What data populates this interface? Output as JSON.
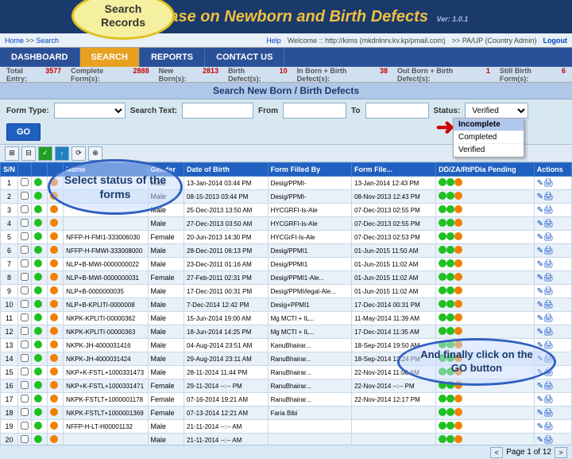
{
  "app": {
    "title": "abase on Newborn and Birth Defects",
    "version": "Ver: 1.0.1",
    "search_records_label": "Search\nRecords"
  },
  "info_bar": {
    "home": "Home",
    "search": "Search",
    "help": "Help",
    "welcome": "Welcome :: http://kims (mkdnlnrv.kv.kp/pmail.com)",
    "location": ">> PA/UP (Country Admin)",
    "logout": "Logout"
  },
  "nav": {
    "items": [
      {
        "label": "DASHBOARD",
        "active": false
      },
      {
        "label": "SEARCH",
        "active": true
      },
      {
        "label": "REPORTS",
        "active": false
      },
      {
        "label": "CONTACT US",
        "active": false
      }
    ]
  },
  "stats": {
    "total_entry": {
      "label": "Total Entry:",
      "value": "3577"
    },
    "complete_forms": {
      "label": "Complete Form(s):",
      "value": "2888"
    },
    "new_borns": {
      "label": "New Born(s):",
      "value": "2813"
    },
    "birth_defects": {
      "label": "Birth Defect(s):",
      "value": "10"
    },
    "in_born": {
      "label": "In Born + Birth Defect(s):",
      "value": "38"
    },
    "out_born": {
      "label": "Out Born + Birth Defect(s):",
      "value": "1"
    },
    "still_birth": {
      "label": "Still Birth Form(s):",
      "value": "6"
    }
  },
  "search_panel": {
    "title": "Search New Born / Birth Defects",
    "form_type_label": "Form Type:",
    "form_type_placeholder": "",
    "search_text_label": "Search Text:",
    "search_text_value": "",
    "from_label": "From",
    "from_value": "",
    "to_label": "To",
    "to_value": "",
    "status_label": "Status:",
    "status_value": "Verified",
    "go_label": "GO"
  },
  "status_options": [
    {
      "label": "Incomplete",
      "selected": true
    },
    {
      "label": "Completed",
      "selected": false
    },
    {
      "label": "Verified",
      "selected": false
    }
  ],
  "table": {
    "headers": [
      "S/N",
      "",
      "",
      "",
      "Name",
      "Gender",
      "Date of Birth",
      "Form Filled By",
      "Form File...",
      "DD/ZA/RtPDia Pending",
      "Actions"
    ],
    "rows": [
      [
        "1",
        "",
        "",
        "",
        "",
        "Male",
        "13-Jan-2014 03:44 PM",
        "Desig/PPMI-",
        "13-Jan-2014 12:43 PM",
        "",
        ""
      ],
      [
        "2",
        "",
        "",
        "",
        "",
        "Male",
        "08-15-2013 03:44 PM",
        "Desig/PPMI-",
        "08-Nov-2013 12:43 PM",
        "",
        ""
      ],
      [
        "3",
        "",
        "",
        "",
        "",
        "Male",
        "25-Dec-2013 13:50 AM",
        "HYCGRFI-Is-Ale",
        "07-Dec-2013 02:55 PM",
        "",
        ""
      ],
      [
        "4",
        "",
        "",
        "",
        "",
        "Male",
        "27-Dec-2013 03:50 AM",
        "HYCGRFI-Is-Ale",
        "07-Dec-2013 02:55 PM",
        "",
        ""
      ],
      [
        "5",
        "",
        "",
        "",
        "NFFP-H-FMI1-333006030",
        "Female",
        "20-Jun-2013 14:30 PM",
        "HYCGrFI-Is-Ale",
        "07-Dec-2013 02:53 PM",
        "",
        ""
      ],
      [
        "6",
        "",
        "",
        "",
        "NFFP-H-FMWI-333008000",
        "Male",
        "28-Dec-2011 06:13 PM",
        "Desig/PPMI1",
        "01-Jun-2015 11:50 AM",
        "",
        ""
      ],
      [
        "7",
        "",
        "",
        "",
        "NLP+B-MWI-0000000022",
        "Male",
        "23-Dec-2011 01:16 AM",
        "Desig/PPMI1",
        "01-Jun-2015 11:02 AM",
        "",
        ""
      ],
      [
        "8",
        "",
        "",
        "",
        "NLP+B-MWI-0000000031",
        "Female",
        "27-Feb-2011 02:31 PM",
        "Desig/PPMI1-Ale...",
        "01-Jun-2015 11:02 AM",
        "",
        ""
      ],
      [
        "9",
        "",
        "",
        "",
        "NLP+B-0000000035",
        "Male",
        "17-Dec-2011 00:31 PM",
        "Desig/PPMI/legal-Ale...",
        "01-Jun-2015 11:02 AM",
        "",
        ""
      ],
      [
        "10",
        "",
        "",
        "",
        "NLP+B-KPLITI-0000008",
        "Male",
        "7-Dec-2014 12:42 PM",
        "Desig+PPMI1",
        "17-Dec-2014 00:31 PM",
        "",
        ""
      ],
      [
        "11",
        "",
        "",
        "",
        "NKPK-KPLITI-00000362",
        "Male",
        "15-Jun-2014 19:00 AM",
        "Mg MCTI + IL...",
        "11-May-2014 11:39 AM",
        "",
        ""
      ],
      [
        "12",
        "",
        "",
        "",
        "NKPK-KPLITI-00000363",
        "Male",
        "18-Jun-2014 14:25 PM",
        "Mg MCTI + IL...",
        "17-Dec-2014 11:35 AM",
        "",
        ""
      ],
      [
        "13",
        "",
        "",
        "",
        "NKPK-JH-4000031416",
        "Male",
        "04-Aug-2014 23:51 AM",
        "KanuBhairar...",
        "18-Sep-2014 19:50 AM",
        "",
        ""
      ],
      [
        "14",
        "",
        "",
        "",
        "NKPK-JH-4000031424",
        "Male",
        "29-Aug-2014 23:11 AM",
        "RanuBhairar...",
        "18-Sep-2014 13:24 PM",
        "",
        ""
      ],
      [
        "15",
        "",
        "",
        "",
        "NKP+K-FSTL+1000331473",
        "Male",
        "28-11-2014 11:44 PM",
        "RanuBhairar...",
        "22-Nov-2014 11:00 AM",
        "",
        ""
      ],
      [
        "16",
        "",
        "",
        "",
        "NKP+K-FSTL+1000331471",
        "Female",
        "29-11-2014 --:-- PM",
        "RanuBhairar...",
        "22-Nov-2014 --:-- PM",
        "",
        ""
      ],
      [
        "17",
        "",
        "",
        "",
        "NKPK-FSTLT+1000001178",
        "Female",
        "07-16-2014 19:21 AM",
        "RanuBhairar...",
        "22-Nov-2014 12:17 PM",
        "",
        ""
      ],
      [
        "18",
        "",
        "",
        "",
        "NKPK-FSTLT+1000001369",
        "Female",
        "07-13-2014 12:21 AM",
        "Faria Bibi",
        "",
        "",
        ""
      ],
      [
        "19",
        "",
        "",
        "",
        "NFFP-H-LT-H00001132",
        "Male",
        "21-11-2014 --:-- AM",
        "",
        "",
        "",
        ""
      ],
      [
        "20",
        "",
        "",
        "",
        "",
        "Male",
        "21-11-2014 --:-- AM",
        "",
        "",
        "",
        ""
      ]
    ]
  },
  "pagination": {
    "page": "1",
    "total_pages": "12",
    "prev": "<",
    "next": ">"
  },
  "annotations": {
    "select_status": "Select status of the\nforms",
    "go_button": "And finally click on the\nGO button"
  }
}
